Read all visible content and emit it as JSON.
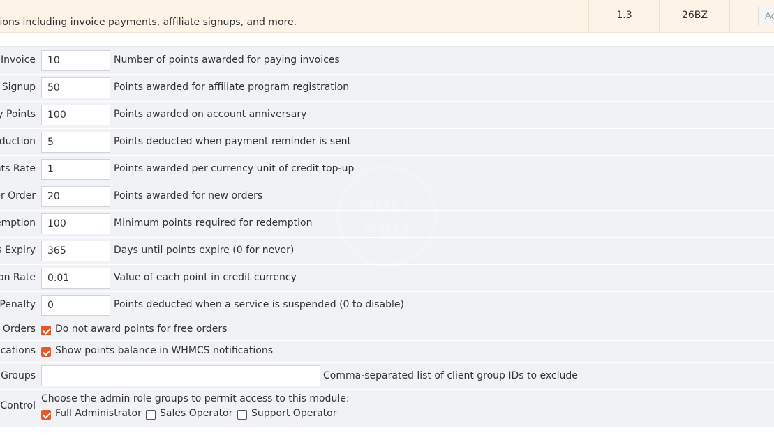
{
  "module": {
    "description": "tions including invoice payments, affiliate signups, and more.",
    "version": "1.3",
    "code": "26BZ",
    "action_label": "Ac"
  },
  "settings": [
    {
      "label": "r Invoice",
      "value": "10",
      "description": "Number of points awarded for paying invoices"
    },
    {
      "label": "e Signup",
      "value": "50",
      "description": "Points awarded for affiliate program registration"
    },
    {
      "label": "y Points",
      "value": "100",
      "description": "Points awarded on account anniversary"
    },
    {
      "label": "eduction",
      "value": "5",
      "description": "Points deducted when payment reminder is sent"
    },
    {
      "label": "nts Rate",
      "value": "1",
      "description": "Points awarded per currency unit of credit top-up"
    },
    {
      "label": "er Order",
      "value": "20",
      "description": "Points awarded for new orders"
    },
    {
      "label": "emption",
      "value": "100",
      "description": "Minimum points required for redemption"
    },
    {
      "label": "s Expiry",
      "value": "365",
      "description": "Days until points expire (0 for never)"
    },
    {
      "label": "on Rate",
      "value": "0.01",
      "description": "Value of each point in credit currency"
    },
    {
      "label": "Penalty",
      "value": "0",
      "description": "Points deducted when a service is suspended (0 to disable)"
    }
  ],
  "checkbox_settings": [
    {
      "label": "e Orders",
      "checked": true,
      "text": "Do not award points for free orders"
    },
    {
      "label": "fications",
      "checked": true,
      "text": "Show points balance in WHMCS notifications"
    }
  ],
  "groups": {
    "label": "Groups",
    "value": "",
    "description": "Comma-separated list of client group IDs to exclude"
  },
  "access": {
    "label": "Control",
    "intro": "Choose the admin role groups to permit access to this module:",
    "roles": [
      {
        "name": "Full Administrator",
        "checked": true
      },
      {
        "name": "Sales Operator",
        "checked": false
      },
      {
        "name": "Support Operator",
        "checked": false
      }
    ]
  },
  "watermark": {
    "line1": "NULL",
    "line2": "PRO"
  },
  "colors": {
    "accent": "#e2592b",
    "module_row_bg": "#fdf3e7",
    "settings_bg": "#f0f2f5"
  }
}
